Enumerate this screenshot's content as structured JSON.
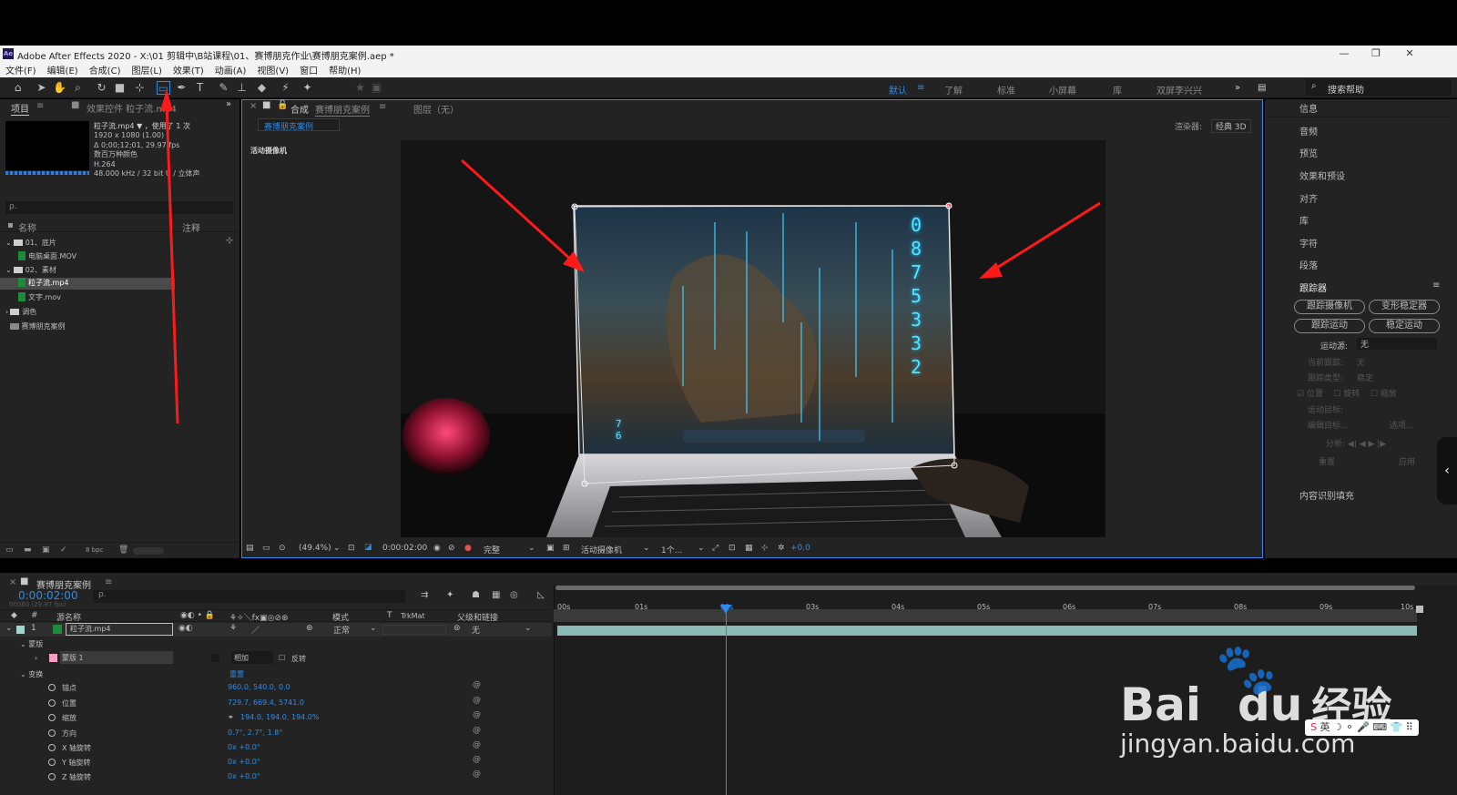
{
  "app": {
    "title": "Adobe After Effects 2020 - X:\\01 剪辑中\\B站课程\\01、赛博朋克作业\\赛博朋克案例.aep *",
    "icon_text": "Ae"
  },
  "menu": [
    "文件(F)",
    "编辑(E)",
    "合成(C)",
    "图层(L)",
    "效果(T)",
    "动画(A)",
    "视图(V)",
    "窗口",
    "帮助(H)"
  ],
  "workspaces": [
    "默认",
    "了解",
    "标准",
    "小屏幕",
    "库",
    "双屏李兴兴"
  ],
  "active_workspace": "默认",
  "help_search": "搜索帮助",
  "project_panel": {
    "tab_project": "项目",
    "tab_effects": "效果控件 粒子流.mp4",
    "asset_name": "粒子流.mp4",
    "asset_used": "，使用了 1 次",
    "asset_res": "1920 x 1080 (1.00)",
    "asset_dur": "Δ 0;00;12;01, 29.97 fps",
    "asset_color": "数百万种颜色",
    "asset_codec": "H.264",
    "asset_audio": "48.000 kHz / 32 bit U / 立体声",
    "search_placeholder": "ρ.",
    "col_name": "名称",
    "col_comment": "注释",
    "tree": [
      {
        "label": "01、底片",
        "type": "folder"
      },
      {
        "label": "电脑桌面.MOV",
        "type": "file"
      },
      {
        "label": "02、素材",
        "type": "folder"
      },
      {
        "label": "粒子流.mp4",
        "type": "file",
        "selected": true
      },
      {
        "label": "文字.mov",
        "type": "file"
      },
      {
        "label": "调色",
        "type": "folder"
      },
      {
        "label": "赛博朋克案例",
        "type": "comp"
      }
    ],
    "bpc": "8 bpc"
  },
  "composition": {
    "tab_label": "合成",
    "comp_name": "赛博朋克案例",
    "layer_tab": "图层（无）",
    "renderer_label": "渲染器:",
    "renderer_value": "经典 3D",
    "camera_label": "活动摄像机",
    "zoom": "(49.4%)",
    "timecode": "0:00:02:00",
    "quality": "完整",
    "view": "活动摄像机",
    "views_count": "1个...",
    "exposure": "+0.0",
    "screen_digits": "0875332",
    "screen_digits_small": "76"
  },
  "right_panel": {
    "items": [
      "信息",
      "音频",
      "预览",
      "效果和预设",
      "对齐",
      "库",
      "字符",
      "段落"
    ],
    "tracker_title": "跟踪器",
    "buttons": [
      "跟踪摄像机",
      "变形稳定器",
      "跟踪运动",
      "稳定运动"
    ],
    "motion_source_label": "运动源:",
    "motion_source_value": "无",
    "current_track_label": "当前跟踪:",
    "current_track_value": "无",
    "track_type_label": "跟踪类型:",
    "track_type_value": "稳定",
    "checks": [
      "位置",
      "旋转",
      "缩放"
    ],
    "motion_target": "运动目标:",
    "edit_target": "编辑目标...",
    "options": "选项...",
    "analyze": "分析:",
    "reset": "重置",
    "apply": "应用",
    "content_fill": "内容识别填充"
  },
  "timeline": {
    "comp_tab": "赛博朋克案例",
    "timecode": "0:00:02:00",
    "fps": "00060 (29.97 fps)",
    "search_placeholder": "ρ.",
    "col_source": "源名称",
    "col_mode": "模式",
    "col_trkmat": "TrkMat",
    "col_parent": "父级和链接",
    "layer_num": "1",
    "layer_name": "粒子流.mp4",
    "layer_mode": "正常",
    "layer_parent": "无",
    "mask_group": "蒙版",
    "mask_name": "蒙版 1",
    "mask_mode": "相加",
    "mask_invert": "反转",
    "transform_group": "变换",
    "reset": "重置",
    "properties": [
      {
        "name": "锚点",
        "value": "960.0, 540.0, 0.0"
      },
      {
        "name": "位置",
        "value": "729.7, 669.4, 5741.0"
      },
      {
        "name": "缩放",
        "value": "194.0, 194.0, 194.0%"
      },
      {
        "name": "方向",
        "value": "0.7°, 2.7°, 1.8°"
      },
      {
        "name": "X 轴旋转",
        "value": "0x +0.0°"
      },
      {
        "name": "Y 轴旋转",
        "value": "0x +0.0°"
      },
      {
        "name": "Z 轴旋转",
        "value": "0x +0.0°"
      }
    ],
    "ruler": [
      "00s",
      "01s",
      "02s",
      "03s",
      "04s",
      "05s",
      "06s",
      "07s",
      "08s",
      "09s",
      "10s"
    ],
    "playhead_time_s": 2
  },
  "watermark": {
    "brand": "Bai",
    "brand2": "du",
    "brand_cn": "经验",
    "url": "jingyan.baidu.com",
    "ime": "英"
  },
  "colors": {
    "accent": "#2d8ceb",
    "panel": "#232323",
    "annotation": "#ff1a1a",
    "digits": "#4fe6ff"
  }
}
